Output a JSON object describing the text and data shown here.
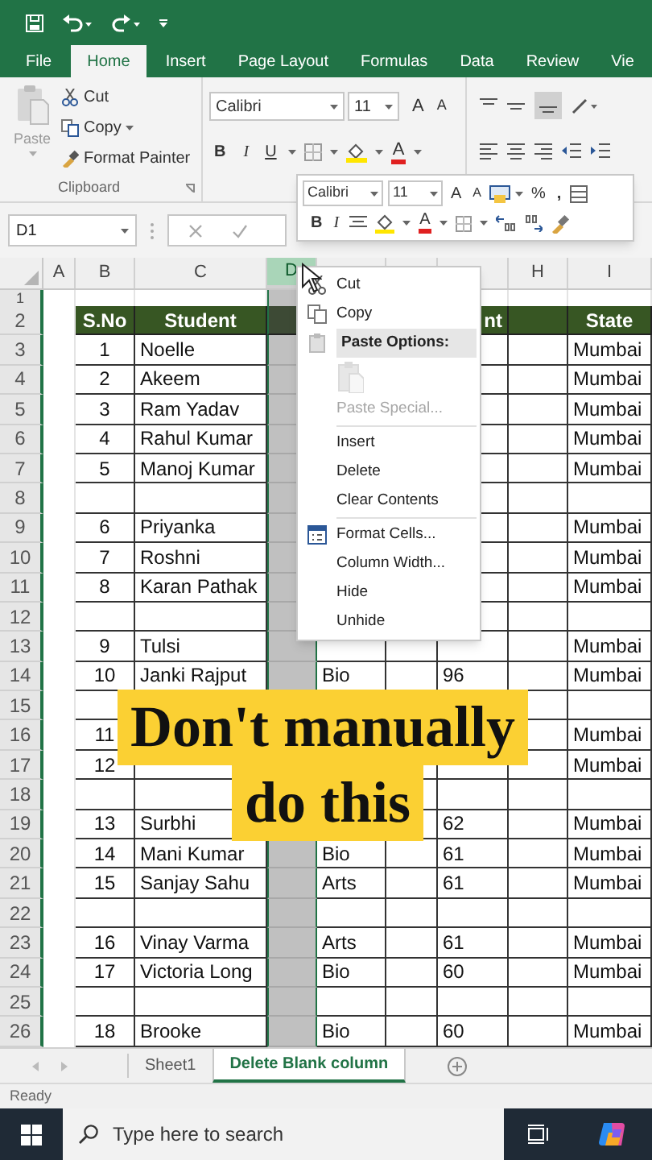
{
  "ribbon_tabs": [
    {
      "label": "File",
      "selected": false
    },
    {
      "label": "Home",
      "selected": true
    },
    {
      "label": "Insert",
      "selected": false
    },
    {
      "label": "Page Layout",
      "selected": false
    },
    {
      "label": "Formulas",
      "selected": false
    },
    {
      "label": "Data",
      "selected": false
    },
    {
      "label": "Review",
      "selected": false
    },
    {
      "label": "Vie",
      "selected": false
    }
  ],
  "clipboard": {
    "paste": "Paste",
    "cut": "Cut",
    "copy": "Copy",
    "format_painter": "Format Painter",
    "label": "Clipboard"
  },
  "font_group": {
    "font": "Calibri",
    "size": "11",
    "grow": "A",
    "shrink": "A",
    "bold": "B",
    "italic": "I",
    "underline": "U",
    "font_color": "A"
  },
  "mini_toolbar": {
    "font": "Calibri",
    "size": "11",
    "grow": "A",
    "shrink": "A",
    "percent": "%",
    "comma": ",",
    "bold": "B",
    "italic": "I",
    "font_color": "A"
  },
  "formula_bar": {
    "name_box": "D1"
  },
  "columns": [
    {
      "label": "A",
      "selected": false
    },
    {
      "label": "B",
      "selected": false
    },
    {
      "label": "C",
      "selected": false
    },
    {
      "label": "D",
      "selected": true
    },
    {
      "selected": false
    },
    {
      "selected": false
    },
    {
      "selected": false
    },
    {
      "label": "H",
      "selected": false
    },
    {
      "label": "I",
      "selected": false
    }
  ],
  "rows": [
    {
      "number": "1",
      "kind": "plain"
    },
    {
      "number": "2",
      "kind": "header",
      "b": "S.No",
      "c": "Student",
      "g": "nt",
      "i": "State"
    },
    {
      "number": "3",
      "kind": "data",
      "b": "1",
      "c": "Noelle",
      "i": "Mumbai"
    },
    {
      "number": "4",
      "kind": "data",
      "b": "2",
      "c": "Akeem",
      "i": "Mumbai"
    },
    {
      "number": "5",
      "kind": "data",
      "b": "3",
      "c": "Ram Yadav",
      "i": "Mumbai"
    },
    {
      "number": "6",
      "kind": "data",
      "b": "4",
      "c": "Rahul Kumar",
      "i": "Mumbai"
    },
    {
      "number": "7",
      "kind": "data",
      "b": "5",
      "c": "Manoj Kumar",
      "i": "Mumbai"
    },
    {
      "number": "8",
      "kind": "data"
    },
    {
      "number": "9",
      "kind": "data",
      "b": "6",
      "c": "Priyanka",
      "i": "Mumbai"
    },
    {
      "number": "10",
      "kind": "data",
      "b": "7",
      "c": "Roshni",
      "i": "Mumbai"
    },
    {
      "number": "11",
      "kind": "data",
      "b": "8",
      "c": "Karan Pathak",
      "i": "Mumbai"
    },
    {
      "number": "12",
      "kind": "data"
    },
    {
      "number": "13",
      "kind": "data",
      "b": "9",
      "c": "Tulsi",
      "i": "Mumbai"
    },
    {
      "number": "14",
      "kind": "data",
      "b": "10",
      "c": "Janki Rajput",
      "e": "Bio",
      "g": "96",
      "i": "Mumbai"
    },
    {
      "number": "15",
      "kind": "data"
    },
    {
      "number": "16",
      "kind": "data",
      "b": "11",
      "i": "Mumbai"
    },
    {
      "number": "17",
      "kind": "data",
      "b": "12",
      "i": "Mumbai"
    },
    {
      "number": "18",
      "kind": "data"
    },
    {
      "number": "19",
      "kind": "data",
      "b": "13",
      "c": "Surbhi",
      "g": "62",
      "i": "Mumbai"
    },
    {
      "number": "20",
      "kind": "data",
      "b": "14",
      "c": "Mani Kumar",
      "e": "Bio",
      "g": "61",
      "i": "Mumbai"
    },
    {
      "number": "21",
      "kind": "data",
      "b": "15",
      "c": "Sanjay Sahu",
      "e": "Arts",
      "g": "61",
      "i": "Mumbai"
    },
    {
      "number": "22",
      "kind": "data"
    },
    {
      "number": "23",
      "kind": "data",
      "b": "16",
      "c": "Vinay Varma",
      "e": "Arts",
      "g": "61",
      "i": "Mumbai"
    },
    {
      "number": "24",
      "kind": "data",
      "b": "17",
      "c": "Victoria Long",
      "e": "Bio",
      "g": "60",
      "i": "Mumbai"
    },
    {
      "number": "25",
      "kind": "data"
    },
    {
      "number": "26",
      "kind": "data",
      "b": "18",
      "c": "Brooke",
      "e": "Bio",
      "g": "60",
      "i": "Mumbai"
    }
  ],
  "context_menu": [
    {
      "kind": "cut",
      "label": "Cut",
      "disabled": false
    },
    {
      "kind": "copy",
      "label": "Copy",
      "disabled": false
    },
    {
      "kind": "heading",
      "label": "Paste Options:",
      "disabled": false
    },
    {
      "kind": "paste",
      "disabled": true
    },
    {
      "kind": "item",
      "label": "Paste Special...",
      "disabled": true
    },
    {
      "kind": "separator"
    },
    {
      "kind": "item",
      "label": "Insert",
      "disabled": false
    },
    {
      "kind": "item",
      "label": "Delete",
      "disabled": false
    },
    {
      "kind": "item",
      "label": "Clear Contents",
      "disabled": false
    },
    {
      "kind": "separator"
    },
    {
      "kind": "format",
      "label": "Format Cells...",
      "disabled": false
    },
    {
      "kind": "item",
      "label": "Column Width...",
      "disabled": false
    },
    {
      "kind": "item",
      "label": "Hide",
      "disabled": false
    },
    {
      "kind": "item",
      "label": "Unhide",
      "disabled": false
    }
  ],
  "caption": [
    "Don't manually",
    "do this"
  ],
  "sheet_tabs": [
    {
      "label": "Sheet1",
      "selected": false
    },
    {
      "label": "Delete Blank column",
      "selected": true
    }
  ],
  "status_bar": "Ready",
  "taskbar": {
    "search_placeholder": "Type here to search"
  }
}
